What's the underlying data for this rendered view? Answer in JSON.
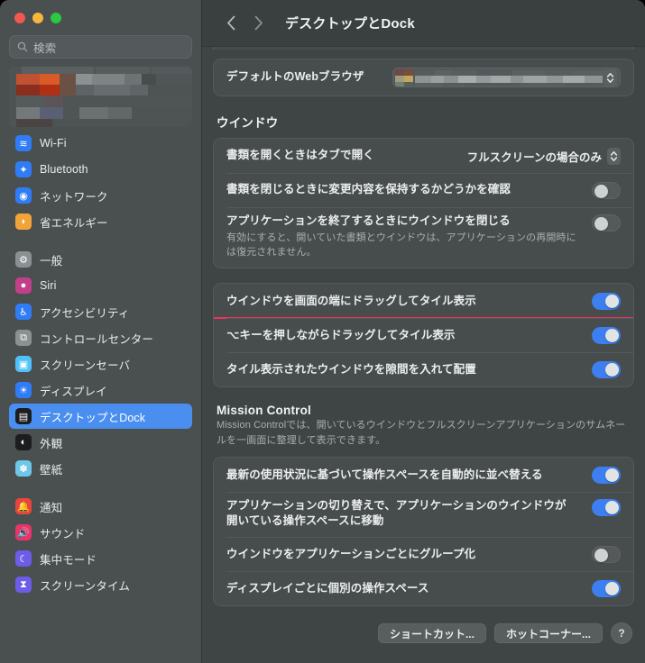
{
  "window": {
    "traffic_lights": [
      "close",
      "minimize",
      "zoom"
    ],
    "colors": {
      "close": "#f1584f",
      "minimize": "#f6b73c",
      "zoom": "#2bc840",
      "accent_blue": "#3d7ff0",
      "selected_blue": "#4a8ef0",
      "annotation_red": "#f0325e",
      "sidebar_bg": "#4a4f50",
      "content_bg": "#3f4445",
      "card_bg": "#474c4d"
    }
  },
  "sidebar": {
    "search": {
      "placeholder": "検索",
      "value": "",
      "icon": "search-icon"
    },
    "profile": {
      "redacted": true,
      "label": ""
    },
    "items": [
      {
        "label": "Wi-Fi",
        "icon": "wifi-icon",
        "icon_bg": "#2f7cf6",
        "glyph": "≋",
        "selected": false,
        "gap_after": false
      },
      {
        "label": "Bluetooth",
        "icon": "bluetooth-icon",
        "icon_bg": "#2f7cf6",
        "glyph": "✦",
        "selected": false,
        "gap_after": false
      },
      {
        "label": "ネットワーク",
        "icon": "network-icon",
        "icon_bg": "#2f7cf6",
        "glyph": "◉",
        "selected": false,
        "gap_after": false
      },
      {
        "label": "省エネルギー",
        "icon": "energy-saver-icon",
        "icon_bg": "#f2a43a",
        "glyph": "◗",
        "selected": false,
        "gap_after": true
      },
      {
        "label": "一般",
        "icon": "general-icon",
        "icon_bg": "#8b9092",
        "glyph": "⚙",
        "selected": false,
        "gap_after": false
      },
      {
        "label": "Siri",
        "icon": "siri-icon",
        "icon_bg": "#c2408a",
        "glyph": "●",
        "selected": false,
        "gap_after": false
      },
      {
        "label": "アクセシビリティ",
        "icon": "accessibility-icon",
        "icon_bg": "#2f7cf6",
        "glyph": "♿",
        "selected": false,
        "gap_after": false
      },
      {
        "label": "コントロールセンター",
        "icon": "control-center-icon",
        "icon_bg": "#8b9092",
        "glyph": "⧉",
        "selected": false,
        "gap_after": false
      },
      {
        "label": "スクリーンセーバ",
        "icon": "screen-saver-icon",
        "icon_bg": "#4fc3f7",
        "glyph": "▣",
        "selected": false,
        "gap_after": false
      },
      {
        "label": "ディスプレイ",
        "icon": "displays-icon",
        "icon_bg": "#2f7cf6",
        "glyph": "☀",
        "selected": false,
        "gap_after": false
      },
      {
        "label": "デスクトップとDock",
        "icon": "desktop-dock-icon",
        "icon_bg": "#1b1d1e",
        "glyph": "▤",
        "selected": true,
        "gap_after": false
      },
      {
        "label": "外観",
        "icon": "appearance-icon",
        "icon_bg": "#1b1d1e",
        "glyph": "◐",
        "selected": false,
        "gap_after": false
      },
      {
        "label": "壁紙",
        "icon": "wallpaper-icon",
        "icon_bg": "#6ec6e8",
        "glyph": "✽",
        "selected": false,
        "gap_after": true
      },
      {
        "label": "通知",
        "icon": "notifications-icon",
        "icon_bg": "#e8453c",
        "glyph": "🔔",
        "selected": false,
        "gap_after": false
      },
      {
        "label": "サウンド",
        "icon": "sound-icon",
        "icon_bg": "#e8336b",
        "glyph": "🔊",
        "selected": false,
        "gap_after": false
      },
      {
        "label": "集中モード",
        "icon": "focus-icon",
        "icon_bg": "#6c5ce7",
        "glyph": "☾",
        "selected": false,
        "gap_after": false
      },
      {
        "label": "スクリーンタイム",
        "icon": "screen-time-icon",
        "icon_bg": "#6c5ce7",
        "glyph": "⧗",
        "selected": false,
        "gap_after": false
      }
    ]
  },
  "toolbar": {
    "back_icon": "chevron-left-icon",
    "forward_icon": "chevron-right-icon",
    "title": "デスクトップとDock"
  },
  "main": {
    "default_browser_row": {
      "label": "デフォルトのWebブラウザ",
      "value": "",
      "value_redacted": true,
      "control": "popup-button"
    },
    "windows_section": {
      "title": "ウインドウ",
      "rows": [
        {
          "label": "書類を開くときはタブで開く",
          "sub": "",
          "control": "popup",
          "value": "フルスクリーンの場合のみ"
        },
        {
          "label": "書類を閉じるときに変更内容を保持するかどうかを確認",
          "sub": "",
          "control": "toggle",
          "value": "off"
        },
        {
          "label": "アプリケーションを終了するときにウインドウを閉じる",
          "sub": "有効にすると、開いていた書類とウインドウは、アプリケーションの再開時には復元されません。",
          "control": "toggle",
          "value": "off"
        }
      ]
    },
    "tiling_section": {
      "rows": [
        {
          "label": "ウインドウを画面の端にドラッグしてタイル表示",
          "control": "toggle",
          "value": "on",
          "annotated": true
        },
        {
          "label": "⌥キーを押しながらドラッグしてタイル表示",
          "control": "toggle",
          "value": "on",
          "annotated": false
        },
        {
          "label": "タイル表示されたウインドウを隙間を入れて配置",
          "control": "toggle",
          "value": "on",
          "annotated": false
        }
      ]
    },
    "mission_control_section": {
      "title": "Mission Control",
      "description": "Mission Controlでは、開いているウインドウとフルスクリーンアプリケーションのサムネールを一画面に整理して表示できます。",
      "rows": [
        {
          "label": "最新の使用状況に基づいて操作スペースを自動的に並べ替える",
          "control": "toggle",
          "value": "on"
        },
        {
          "label": "アプリケーションの切り替えで、アプリケーションのウインドウが開いている操作スペースに移動",
          "control": "toggle",
          "value": "on"
        },
        {
          "label": "ウインドウをアプリケーションごとにグループ化",
          "control": "toggle",
          "value": "off"
        },
        {
          "label": "ディスプレイごとに個別の操作スペース",
          "control": "toggle",
          "value": "on"
        }
      ]
    },
    "buttons": {
      "shortcuts": "ショートカット...",
      "hot_corners": "ホットコーナー...",
      "help": "?"
    }
  }
}
